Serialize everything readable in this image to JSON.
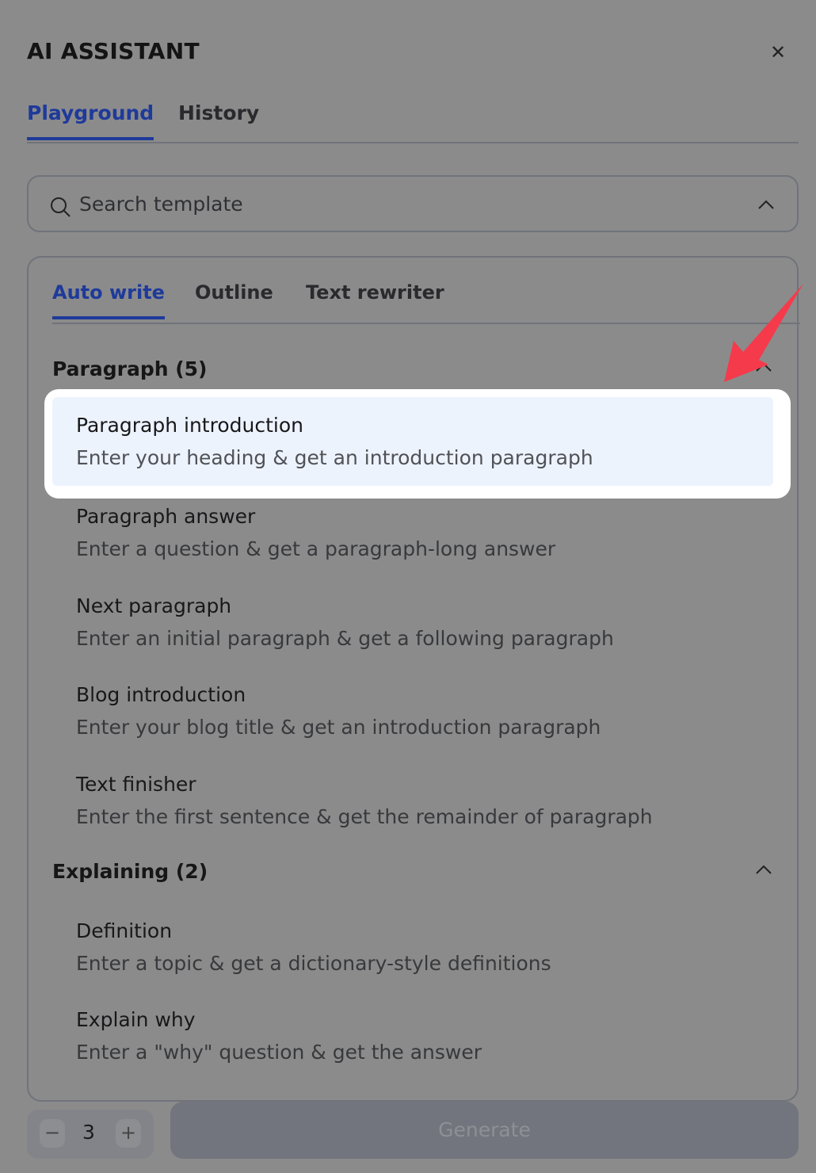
{
  "header": {
    "title": "AI ASSISTANT",
    "close_icon": "close-icon"
  },
  "tabs": [
    {
      "label": "Playground",
      "active": true
    },
    {
      "label": "History",
      "active": false
    }
  ],
  "search": {
    "placeholder": "Search template",
    "icon": "search-icon",
    "expanded": true
  },
  "subtabs": [
    {
      "label": "Auto write",
      "active": true
    },
    {
      "label": "Outline",
      "active": false
    },
    {
      "label": "Text rewriter",
      "active": false
    }
  ],
  "sections": [
    {
      "title": "Paragraph (5)",
      "items": [
        {
          "title": "Paragraph introduction",
          "desc": "Enter your heading & get an introduction paragraph",
          "highlighted": true
        },
        {
          "title": "Paragraph answer",
          "desc": "Enter a question & get a paragraph-long answer"
        },
        {
          "title": "Next paragraph",
          "desc": "Enter an initial paragraph & get a following paragraph"
        },
        {
          "title": "Blog introduction",
          "desc": "Enter your blog title & get an introduction paragraph"
        },
        {
          "title": "Text finisher",
          "desc": "Enter the first sentence & get the remainder of paragraph"
        }
      ]
    },
    {
      "title": "Explaining (2)",
      "items": [
        {
          "title": "Definition",
          "desc": "Enter a topic & get a dictionary-style definitions"
        },
        {
          "title": "Explain why",
          "desc": "Enter a \"why\" question & get the answer"
        }
      ]
    }
  ],
  "footer": {
    "count": "3",
    "minus": "−",
    "plus": "+",
    "generate_label": "Generate"
  },
  "colors": {
    "accent": "#1e3a9a",
    "arrow": "#f53a4b",
    "highlight": "#edf3fd"
  }
}
